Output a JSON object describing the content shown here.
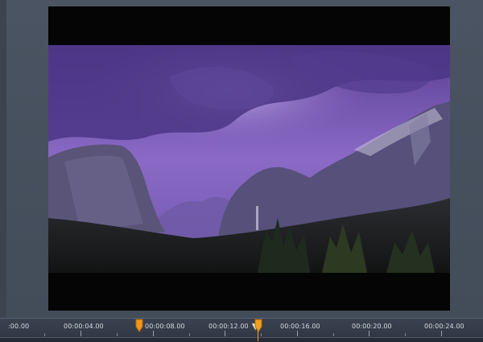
{
  "viewer": {
    "letterbox_color": "#050505",
    "sky_color": "#7a5ab4",
    "content": "valley landscape under purple storm clouds"
  },
  "timeline": {
    "labels": [
      ":00.00",
      "00:00:04.00",
      "00:00:08.00",
      "00:00:12.00",
      "00:00:16.00",
      "00:00:20.00",
      "00:00:24.00"
    ],
    "in_marker_color": "#f0961e",
    "playhead_color": "#f0a020",
    "out_marker_color": "#e8e8e8"
  }
}
